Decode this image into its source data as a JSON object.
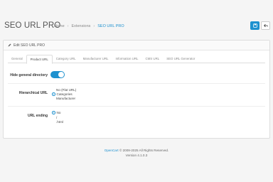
{
  "header": {
    "title": "SEO URL PRO",
    "breadcrumb": [
      "Home",
      "Extensions",
      "SEO URL PRO"
    ],
    "save_icon": "save-icon",
    "back_icon": "back-icon"
  },
  "card": {
    "title": "Edit SEO URL PRO",
    "tabs": [
      "General",
      "Product URL",
      "Category URL",
      "Manufacturer URL",
      "Information URL",
      "CMS URL",
      "SEO URL Generator"
    ],
    "active_tab": "Product URL"
  },
  "form": {
    "hide_general_directory": {
      "label": "Hide general directory",
      "enabled": true
    },
    "hierarchical_url": {
      "label": "Hierarchical URL",
      "options": [
        "No (Flat URL)",
        "Categories",
        "Manufacturer"
      ],
      "selected": "Categories"
    },
    "url_ending": {
      "label": "URL ending",
      "options": [
        "No",
        "/",
        ".html"
      ],
      "selected": "No"
    }
  },
  "footer": {
    "brand": "OpenCart",
    "copyright": "© 2009-2025 All Rights Reserved.",
    "version": "Version 4.1.0.3"
  },
  "colors": {
    "accent": "#1e91cf",
    "background": "#f5f5f5"
  }
}
